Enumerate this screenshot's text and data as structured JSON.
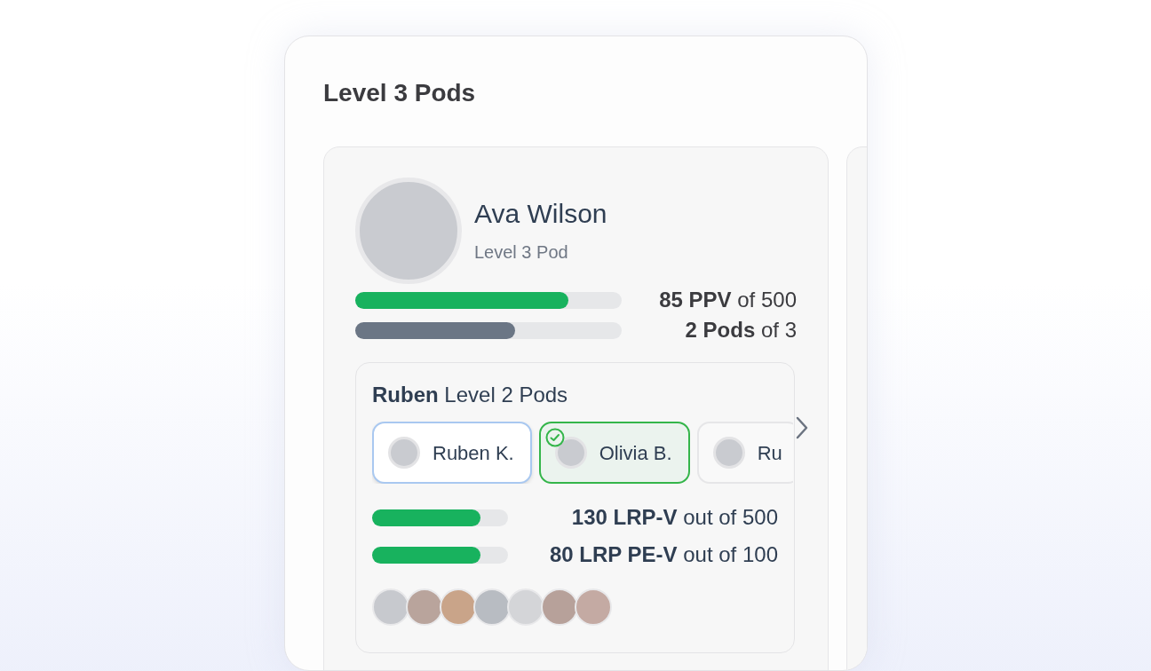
{
  "section": {
    "title": "Level 3 Pods"
  },
  "profile": {
    "name": "Ava Wilson",
    "subtitle": "Level 3 Pod"
  },
  "progress": [
    {
      "kind": "primary",
      "text": "**85 PPV** of 500",
      "level": 0.8
    },
    {
      "kind": "secondary",
      "text": "**2 Pods** of 3",
      "level": 0.6
    }
  ],
  "subpods": {
    "title": "**Ruben** Level 2 Pods",
    "chips": [
      {
        "name": "Ruben K.",
        "selected": true,
        "checked": false
      },
      {
        "name": "Olivia B.",
        "selected": false,
        "checked": true
      },
      {
        "name": "Ru",
        "selected": false,
        "checked": false
      }
    ],
    "progress": [
      {
        "text": "**130 LRP-V** out of 500",
        "level": 0.8
      },
      {
        "text": "**80 LRP PE-V** out of 100",
        "level": 0.8
      }
    ]
  }
}
